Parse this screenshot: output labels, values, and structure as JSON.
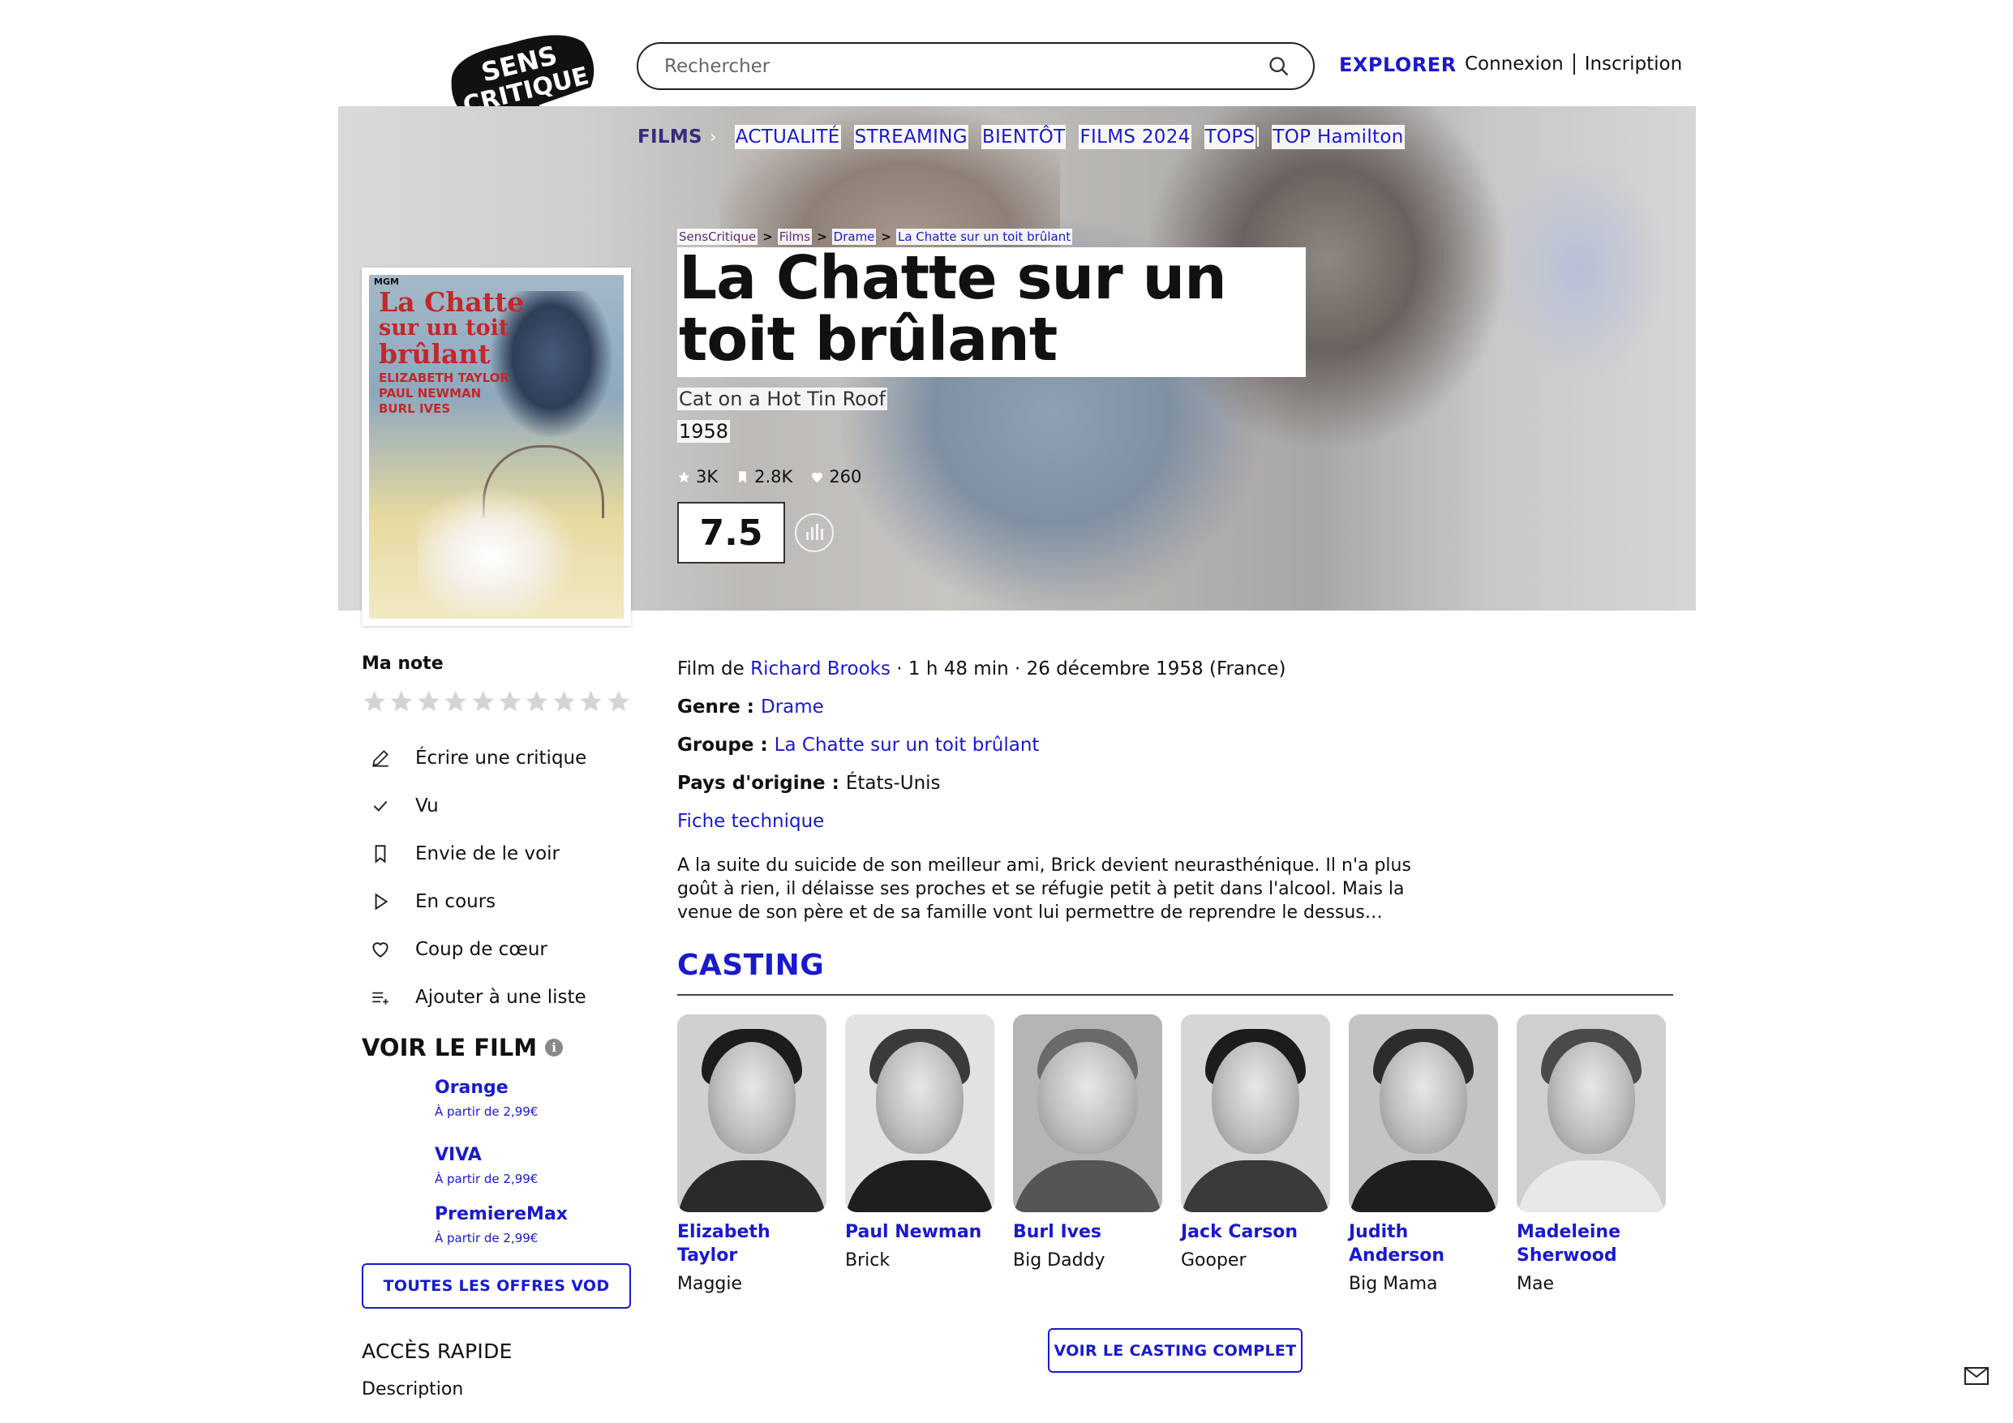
{
  "header": {
    "logo_text": "SENS CRITIQUE",
    "search_placeholder": "Rechercher",
    "explorer_label": "EXPLORER",
    "login_label": "Connexion",
    "signup_label": "Inscription"
  },
  "nav": {
    "films": "FILMS",
    "items": [
      "ACTUALITÉ",
      "STREAMING",
      "BIENTÔT",
      "FILMS 2024",
      "TOPS"
    ],
    "top": "TOP Hamilton"
  },
  "breadcrumb": [
    "SensCritique",
    "Films",
    "Drame",
    "La Chatte sur un toit brûlant"
  ],
  "film": {
    "title": "La Chatte sur un toit brûlant",
    "original_title": "Cat on a Hot Tin Roof",
    "year": "1958",
    "stats": {
      "ratings": "3K",
      "wishes": "2.8K",
      "favorites": "260"
    },
    "score": "7.5",
    "film_de_label": "Film de ",
    "director": "Richard Brooks",
    "duration_release": " · 1 h 48 min · 26 décembre 1958 (France)",
    "genre_label": "Genre : ",
    "genre": "Drame",
    "groupe_label": "Groupe : ",
    "groupe": "La Chatte sur un toit brûlant",
    "pays_label": "Pays d'origine : ",
    "pays": "États-Unis",
    "fiche_label": "Fiche technique",
    "synopsis": "A la suite du suicide de son meilleur ami, Brick devient neurasthénique. Il n'a plus goût à rien, il délaisse ses proches et se réfugie petit à petit dans l'alcool. Mais la venue de son père et de sa famille vont lui permettre de reprendre le dessus…"
  },
  "poster": {
    "studio": "MGM",
    "title_lines": [
      "La Chatte",
      "sur un toit",
      "brûlant"
    ],
    "names": [
      "ELIZABETH TAYLOR",
      "PAUL NEWMAN",
      "BURL IVES"
    ]
  },
  "sidebar": {
    "ma_note": "Ma note",
    "star_count": 10,
    "actions": [
      {
        "label": "Écrire une critique",
        "icon": "pencil-icon"
      },
      {
        "label": "Vu",
        "icon": "check-icon"
      },
      {
        "label": "Envie de le voir",
        "icon": "bookmark-icon"
      },
      {
        "label": "En cours",
        "icon": "play-icon"
      },
      {
        "label": "Coup de cœur",
        "icon": "heart-icon"
      },
      {
        "label": "Ajouter à une liste",
        "icon": "list-add-icon"
      }
    ],
    "voir_title": "VOIR LE FILM",
    "offers": [
      {
        "name": "Orange",
        "price": "À partir de 2,99€"
      },
      {
        "name": "VIVA",
        "price": "À partir de 2,99€"
      },
      {
        "name": "PremiereMax",
        "price": "À partir de 2,99€"
      }
    ],
    "vod_button": "TOUTES LES OFFRES VOD",
    "acces_rapide": "ACCÈS RAPIDE",
    "description_link": "Description"
  },
  "casting": {
    "title": "CASTING",
    "actors": [
      {
        "name": "Elizabeth Taylor",
        "role": "Maggie"
      },
      {
        "name": "Paul Newman",
        "role": "Brick"
      },
      {
        "name": "Burl Ives",
        "role": "Big Daddy"
      },
      {
        "name": "Jack Carson",
        "role": "Gooper"
      },
      {
        "name": "Judith Anderson",
        "role": "Big Mama"
      },
      {
        "name": "Madeleine Sherwood",
        "role": "Mae"
      }
    ],
    "full_button": "VOIR LE CASTING COMPLET"
  },
  "colors": {
    "accent": "#1a1acc",
    "text": "#111111"
  }
}
